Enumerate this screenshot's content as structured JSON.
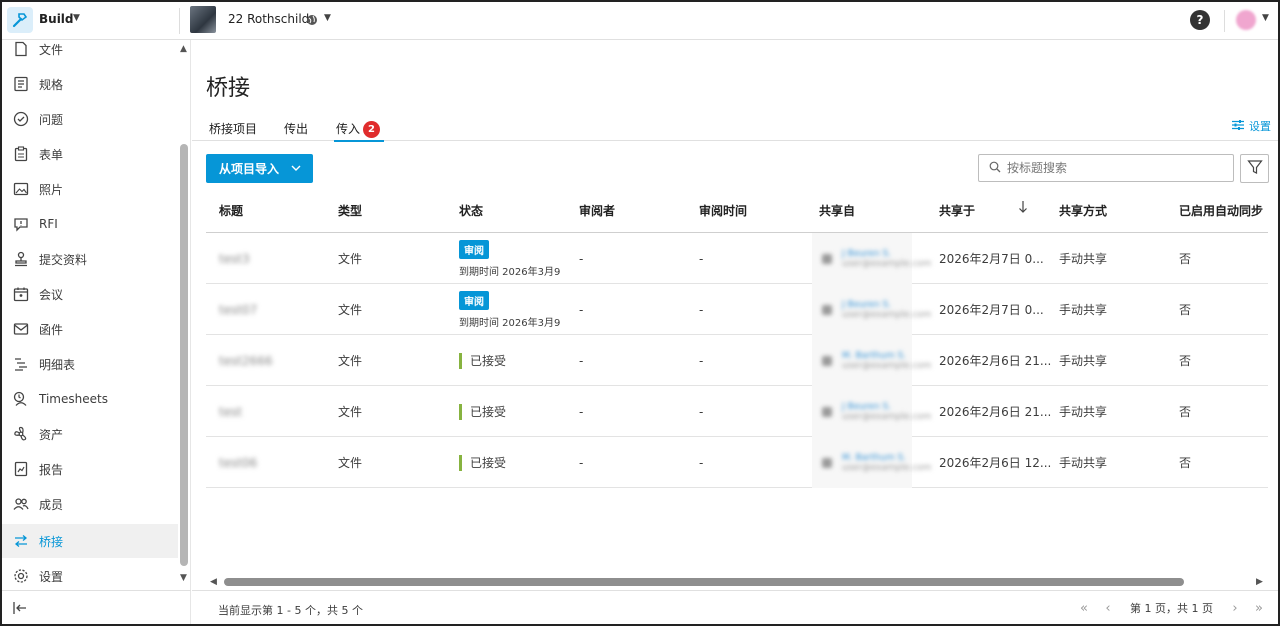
{
  "topbar": {
    "app_name": "Build",
    "project_name": "22 Rothschild"
  },
  "sidebar": {
    "items": [
      {
        "label": "文件",
        "icon": "file-icon"
      },
      {
        "label": "规格",
        "icon": "specs-icon"
      },
      {
        "label": "问题",
        "icon": "issues-icon"
      },
      {
        "label": "表单",
        "icon": "forms-icon"
      },
      {
        "label": "照片",
        "icon": "photos-icon"
      },
      {
        "label": "RFI",
        "icon": "rfi-icon"
      },
      {
        "label": "提交资料",
        "icon": "submittals-icon"
      },
      {
        "label": "会议",
        "icon": "meetings-icon"
      },
      {
        "label": "函件",
        "icon": "correspondence-icon"
      },
      {
        "label": "明细表",
        "icon": "schedule-icon"
      },
      {
        "label": "Timesheets",
        "icon": "timesheets-icon"
      },
      {
        "label": "资产",
        "icon": "assets-icon"
      },
      {
        "label": "报告",
        "icon": "reports-icon"
      },
      {
        "label": "成员",
        "icon": "members-icon"
      },
      {
        "label": "桥接",
        "icon": "bridge-icon",
        "active": true
      },
      {
        "label": "设置",
        "icon": "settings-icon"
      }
    ]
  },
  "page": {
    "title": "桥接",
    "tabs": [
      {
        "label": "桥接项目"
      },
      {
        "label": "传出"
      },
      {
        "label": "传入",
        "badge": "2",
        "active": true
      }
    ],
    "settings_label": "设置",
    "import_button": "从项目导入",
    "search_placeholder": "按标题搜索"
  },
  "table": {
    "columns": [
      "标题",
      "类型",
      "状态",
      "审阅者",
      "审阅时间",
      "共享自",
      "共享于",
      "共享方式",
      "已启用自动同步"
    ],
    "rows": [
      {
        "title": "test3",
        "type": "文件",
        "status": "审阅",
        "due": "到期时间 2026年3月9",
        "reviewer": "-",
        "review_time": "-",
        "sharer_name": "J Beuren S.",
        "sharer_email": "user@example.com",
        "shared_at": "2026年2月7日 0...",
        "share_method": "手动共享",
        "auto_sync": "否"
      },
      {
        "title": "test07",
        "type": "文件",
        "status": "审阅",
        "due": "到期时间 2026年3月9",
        "reviewer": "-",
        "review_time": "-",
        "sharer_name": "J Beuren S.",
        "sharer_email": "user@example.com",
        "shared_at": "2026年2月7日 0...",
        "share_method": "手动共享",
        "auto_sync": "否"
      },
      {
        "title": "test2666",
        "type": "文件",
        "status": "已接受",
        "due": "",
        "reviewer": "-",
        "review_time": "-",
        "sharer_name": "M. Barthum S.",
        "sharer_email": "user@example.com",
        "shared_at": "2026年2月6日 21...",
        "share_method": "手动共享",
        "auto_sync": "否"
      },
      {
        "title": "test",
        "type": "文件",
        "status": "已接受",
        "due": "",
        "reviewer": "-",
        "review_time": "-",
        "sharer_name": "J Beuren S.",
        "sharer_email": "user@example.com",
        "shared_at": "2026年2月6日 21...",
        "share_method": "手动共享",
        "auto_sync": "否"
      },
      {
        "title": "test06",
        "type": "文件",
        "status": "已接受",
        "due": "",
        "reviewer": "-",
        "review_time": "-",
        "sharer_name": "M. Barthum S.",
        "sharer_email": "user@example.com",
        "shared_at": "2026年2月6日 12...",
        "share_method": "手动共享",
        "auto_sync": "否"
      }
    ]
  },
  "footer": {
    "count_text": "当前显示第 1 - 5 个，共 5 个",
    "page_text": "第 1 页，共 1 页"
  },
  "colors": {
    "accent": "#0696d7",
    "badge": "#e02c2c",
    "accepted": "#87b340"
  }
}
